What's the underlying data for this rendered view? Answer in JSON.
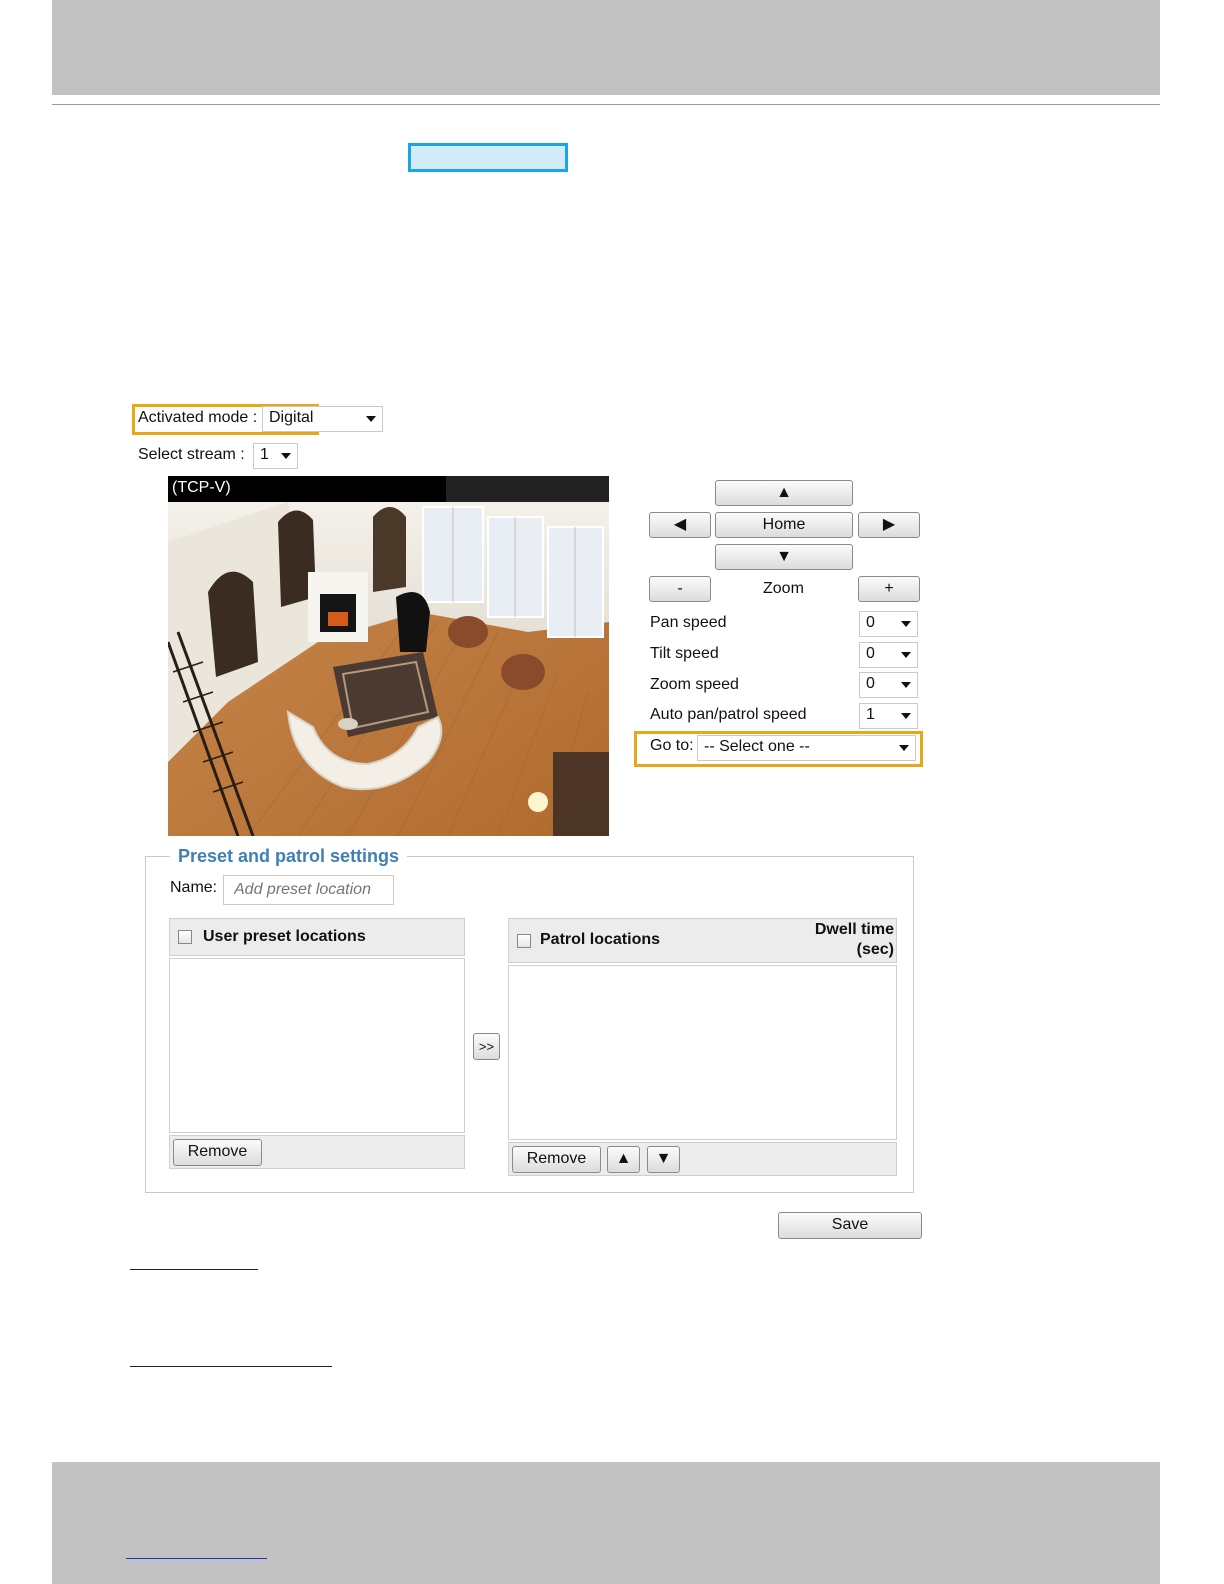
{
  "mode": {
    "label": "Activated mode :",
    "value": "Digital"
  },
  "stream": {
    "label": "Select stream :",
    "value": "1"
  },
  "video": {
    "title": "(TCP-V)"
  },
  "ptz": {
    "up_symbol": "▲",
    "down_symbol": "▼",
    "left_symbol": "◀",
    "right_symbol": "▶",
    "home_label": "Home",
    "zoom_label": "Zoom",
    "zoom_out_label": "-",
    "zoom_in_label": "+"
  },
  "speeds": [
    {
      "label": "Pan speed",
      "value": "0"
    },
    {
      "label": "Tilt speed",
      "value": "0"
    },
    {
      "label": "Zoom speed",
      "value": "0"
    },
    {
      "label": "Auto pan/patrol speed",
      "value": "1"
    }
  ],
  "goto": {
    "label": "Go to:",
    "value": "-- Select one --"
  },
  "preset": {
    "legend": "Preset and patrol settings",
    "name_label": "Name:",
    "name_placeholder": "Add preset location",
    "user_presets_title": "User preset locations",
    "patrol_title": "Patrol locations",
    "dwell_line1": "Dwell time",
    "dwell_line2": "(sec)",
    "move_label": ">>",
    "remove_left": "Remove",
    "remove_right": "Remove",
    "up_symbol": "▲",
    "down_symbol": "▼"
  },
  "save_label": "Save",
  "colors": {
    "frame_highlight": "#e6a817",
    "box_highlight": "#1aa6e6",
    "legend": "#3f7fb5"
  }
}
